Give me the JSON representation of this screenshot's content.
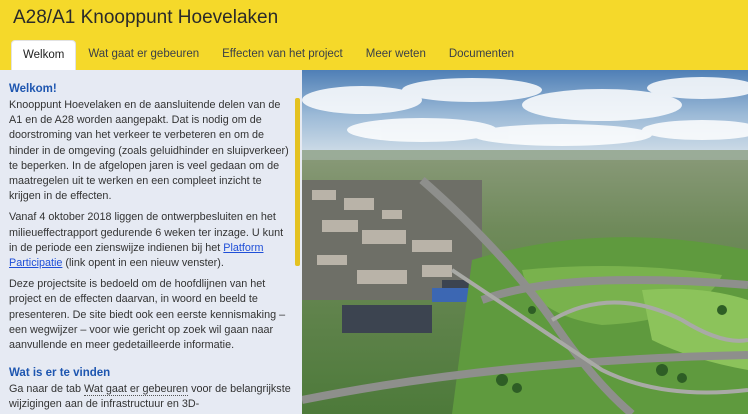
{
  "site": {
    "title": "A28/A1 Knooppunt Hoevelaken"
  },
  "tabs": [
    {
      "label": "Welkom",
      "active": true
    },
    {
      "label": "Wat gaat er gebeuren",
      "active": false
    },
    {
      "label": "Effecten van het project",
      "active": false
    },
    {
      "label": "Meer weten",
      "active": false
    },
    {
      "label": "Documenten",
      "active": false
    }
  ],
  "welcome": {
    "heading": "Welkom!",
    "p1": "Knooppunt Hoevelaken en de aansluitende delen van de A1 en de A28 worden aangepakt. Dat is nodig om de doorstroming van het verkeer te verbeteren en om de hinder in de omgeving (zoals geluidhinder en sluipverkeer) te beperken. In de afgelopen jaren is veel gedaan om de maatregelen uit te werken en een compleet inzicht te krijgen in de effecten.",
    "p2_text": "Vanaf 4 oktober 2018 liggen de ontwerpbesluiten en het milieueffectrapport gedurende 6 weken ter inzage. U kunt in de periode een zienswijze indienen bij het ",
    "p2_link": "Platform Participatie",
    "p2_suffix": " (link opent in een nieuw venster).",
    "p3": "Deze projectsite is bedoeld om de hoofdlijnen van het project en de effecten daarvan, in woord en beeld te presenteren. De site biedt ook een eerste kennismaking – een wegwijzer – voor wie gericht op zoek wil gaan naar aanvullende en meer gedetailleerde informatie."
  },
  "find": {
    "heading": "Wat is er te vinden",
    "text_prefix": "Ga naar de tab ",
    "text_link": "Wat gaat er gebeuren",
    "text_suffix": " voor de belangrijkste wijzigingen aan de infrastructuur en 3D-"
  },
  "colors": {
    "header_bg": "#f5d92a",
    "sidebar_bg": "#e6eaf3",
    "heading_blue": "#1e56b0",
    "link_blue": "#1f4fd8"
  },
  "hero": {
    "image": "aerial-view-interchange"
  }
}
